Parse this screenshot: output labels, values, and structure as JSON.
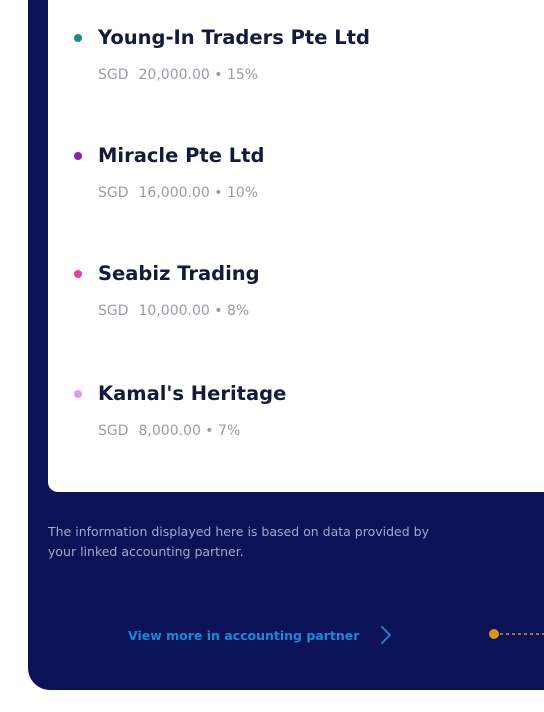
{
  "companies": [
    {
      "name": "Young-In Traders Pte Ltd",
      "currency": "SGD",
      "amount": "20,000.00",
      "percent": "15%",
      "color": "#1a8a86"
    },
    {
      "name": "Miracle Pte Ltd",
      "currency": "SGD",
      "amount": "16,000.00",
      "percent": "10%",
      "color": "#8a1fa8"
    },
    {
      "name": "Seabiz Trading",
      "currency": "SGD",
      "amount": "10,000.00",
      "percent": "8%",
      "color": "#ea3fa7"
    },
    {
      "name": "Kamal's Heritage",
      "currency": "SGD",
      "amount": "8,000.00",
      "percent": "7%",
      "color": "#dc9ae4"
    }
  ],
  "footer": {
    "info_line1": "The information displayed here is based on data provided by",
    "info_line2": "your linked accounting partner.",
    "view_more_label": "View more in accounting partner",
    "chevron_icon": "chevron-right-icon",
    "accent_color": "#1f88d6",
    "marker_color": "#d9961e"
  }
}
